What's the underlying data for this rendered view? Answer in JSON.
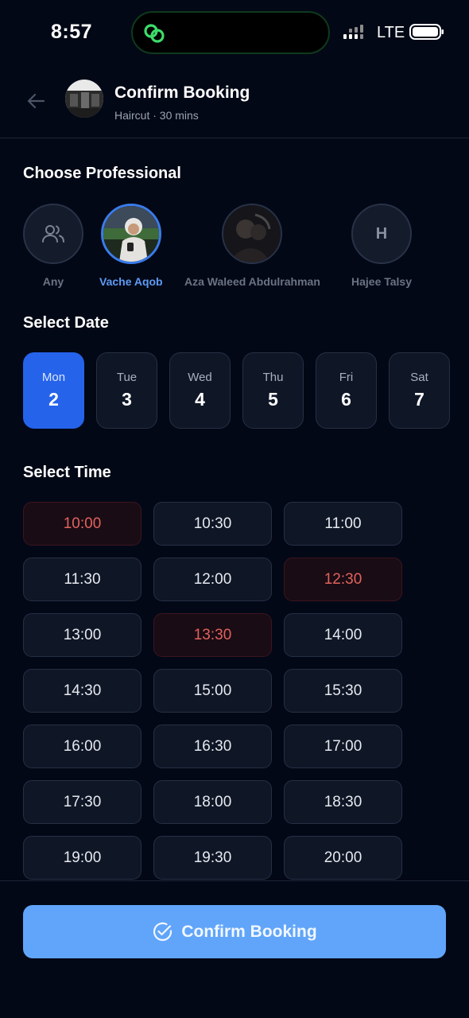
{
  "status_bar": {
    "time": "8:57",
    "network": "LTE"
  },
  "header": {
    "title": "Confirm Booking",
    "subtitle": "Haircut · 30 mins"
  },
  "professional_section": {
    "title": "Choose Professional",
    "items": [
      {
        "name": "Any",
        "icon": "users-icon",
        "selected": false
      },
      {
        "name": "Vache Aqob",
        "selected": true
      },
      {
        "name": "Aza Waleed Abdulrahman",
        "selected": false
      },
      {
        "name": "Hajee Talsy",
        "initial": "H",
        "selected": false
      }
    ]
  },
  "date_section": {
    "title": "Select Date",
    "dates": [
      {
        "day": "Mon",
        "num": "2",
        "selected": true
      },
      {
        "day": "Tue",
        "num": "3"
      },
      {
        "day": "Wed",
        "num": "4"
      },
      {
        "day": "Thu",
        "num": "5"
      },
      {
        "day": "Fri",
        "num": "6"
      },
      {
        "day": "Sat",
        "num": "7"
      }
    ]
  },
  "time_section": {
    "title": "Select Time",
    "slots": [
      {
        "time": "10:00",
        "booked": true
      },
      {
        "time": "10:30"
      },
      {
        "time": "11:00"
      },
      {
        "time": "11:30"
      },
      {
        "time": "12:00"
      },
      {
        "time": "12:30",
        "booked": true
      },
      {
        "time": "13:00"
      },
      {
        "time": "13:30",
        "booked": true
      },
      {
        "time": "14:00"
      },
      {
        "time": "14:30"
      },
      {
        "time": "15:00"
      },
      {
        "time": "15:30"
      },
      {
        "time": "16:00"
      },
      {
        "time": "16:30"
      },
      {
        "time": "17:00"
      },
      {
        "time": "17:30"
      },
      {
        "time": "18:00"
      },
      {
        "time": "18:30"
      },
      {
        "time": "19:00"
      },
      {
        "time": "19:30"
      },
      {
        "time": "20:00"
      }
    ]
  },
  "footer": {
    "confirm_label": "Confirm Booking",
    "icon": "check-circle-icon"
  },
  "colors": {
    "background": "#030816",
    "accent": "#2563eb",
    "button": "#60a5fa",
    "booked_text": "#e0625d",
    "selected_name": "#5e9bf5"
  }
}
